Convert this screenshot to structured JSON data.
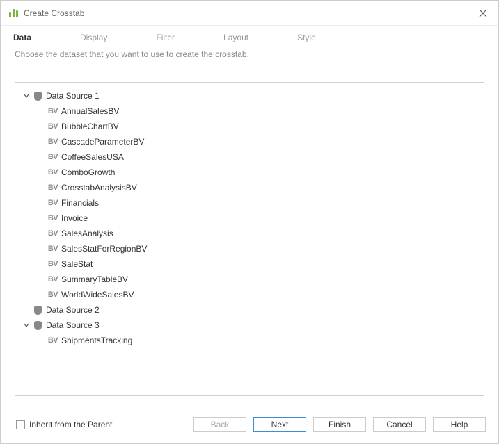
{
  "title": "Create Crosstab",
  "steps": [
    {
      "label": "Data",
      "active": true
    },
    {
      "label": "Display",
      "active": false
    },
    {
      "label": "Filter",
      "active": false
    },
    {
      "label": "Layout",
      "active": false
    },
    {
      "label": "Style",
      "active": false
    }
  ],
  "subtitle": "Choose the dataset that you want to use to create the crosstab.",
  "tree": [
    {
      "label": "Data Source 1",
      "type": "datasource",
      "expanded": true,
      "level": 0,
      "children": [
        {
          "label": "AnnualSalesBV",
          "type": "bv",
          "level": 1
        },
        {
          "label": "BubbleChartBV",
          "type": "bv",
          "level": 1
        },
        {
          "label": "CascadeParameterBV",
          "type": "bv",
          "level": 1
        },
        {
          "label": "CoffeeSalesUSA",
          "type": "bv",
          "level": 1
        },
        {
          "label": "ComboGrowth",
          "type": "bv",
          "level": 1
        },
        {
          "label": "CrosstabAnalysisBV",
          "type": "bv",
          "level": 1
        },
        {
          "label": "Financials",
          "type": "bv",
          "level": 1
        },
        {
          "label": "Invoice",
          "type": "bv",
          "level": 1
        },
        {
          "label": "SalesAnalysis",
          "type": "bv",
          "level": 1
        },
        {
          "label": "SalesStatForRegionBV",
          "type": "bv",
          "level": 1
        },
        {
          "label": "SaleStat",
          "type": "bv",
          "level": 1
        },
        {
          "label": "SummaryTableBV",
          "type": "bv",
          "level": 1
        },
        {
          "label": "WorldWideSalesBV",
          "type": "bv",
          "level": 1
        }
      ]
    },
    {
      "label": "Data Source 2",
      "type": "datasource",
      "expanded": false,
      "level": 0
    },
    {
      "label": "Data Source 3",
      "type": "datasource",
      "expanded": true,
      "level": 0,
      "children": [
        {
          "label": "ShipmentsTracking",
          "type": "bv",
          "level": 1
        }
      ]
    }
  ],
  "inheritCheckbox": {
    "label": "Inherit from the Parent",
    "checked": false
  },
  "buttons": {
    "back": "Back",
    "next": "Next",
    "finish": "Finish",
    "cancel": "Cancel",
    "help": "Help"
  }
}
